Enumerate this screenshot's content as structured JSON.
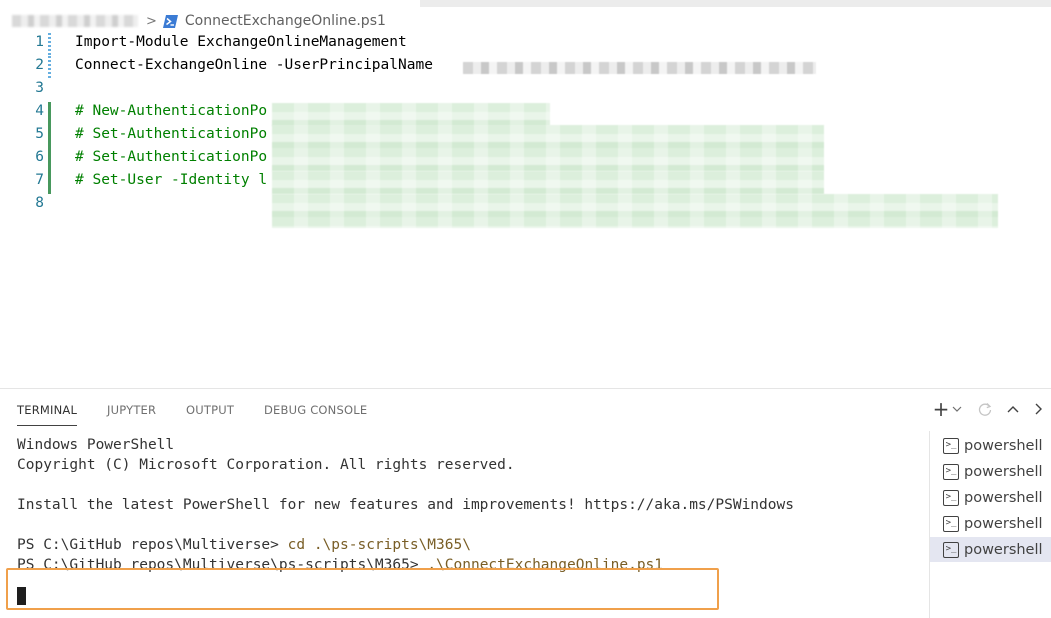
{
  "breadcrumb": {
    "file_name": "ConnectExchangeOnline.ps1",
    "separator": ">"
  },
  "editor": {
    "lines": [
      {
        "number": "1",
        "text": "Import-Module ExchangeOnlineManagement"
      },
      {
        "number": "2",
        "text": "Connect-ExchangeOnline -UserPrincipalName "
      },
      {
        "number": "3",
        "text": ""
      },
      {
        "number": "4",
        "text": "# New-AuthenticationPo"
      },
      {
        "number": "5",
        "text": "# Set-AuthenticationPo"
      },
      {
        "number": "6",
        "text": "# Set-AuthenticationPo"
      },
      {
        "number": "7",
        "text": "# Set-User -Identity l"
      },
      {
        "number": "8",
        "text": ""
      }
    ]
  },
  "panel": {
    "tabs": [
      "TERMINAL",
      "JUPYTER",
      "OUTPUT",
      "DEBUG CONSOLE"
    ],
    "actions": {
      "new_terminal": "+",
      "dropdown": "⌄",
      "restart": "↻",
      "maximize": "^",
      "more": ">"
    }
  },
  "terminal": {
    "lines": [
      "Windows PowerShell",
      "Copyright (C) Microsoft Corporation. All rights reserved.",
      "",
      "Install the latest PowerShell for new features and improvements! https://aka.ms/PSWindows",
      "",
      "PS C:\\GitHub repos\\Multiverse> "
    ],
    "cmd1_prompt": "PS C:\\GitHub repos\\Multiverse> ",
    "cmd1": "cd .\\ps-scripts\\M365\\",
    "cmd2_prompt": "PS C:\\GitHub repos\\Multiverse\\ps-scripts\\M365> ",
    "cmd2": ".\\ConnectExchangeOnline.ps1",
    "highlight_color": "#f0a04b"
  },
  "terminal_list": {
    "items": [
      "powershell",
      "powershell",
      "powershell",
      "powershell",
      "powershell"
    ],
    "active_index": 4
  },
  "colors": {
    "line_number": "#237893",
    "comment": "#008000",
    "command": "#795e26",
    "active_terminal_bg": "#e4e6f1"
  }
}
